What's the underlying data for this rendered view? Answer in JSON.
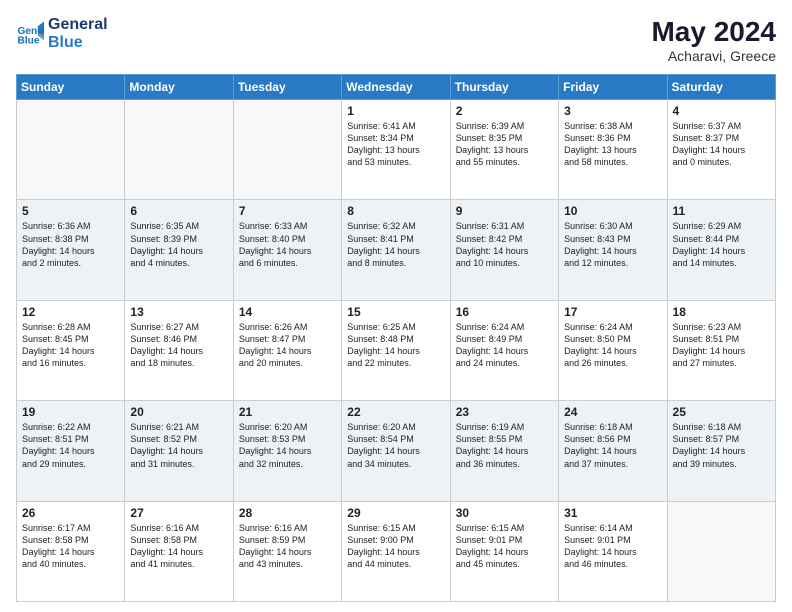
{
  "header": {
    "logo_line1": "General",
    "logo_line2": "Blue",
    "month_year": "May 2024",
    "location": "Acharavi, Greece"
  },
  "days_of_week": [
    "Sunday",
    "Monday",
    "Tuesday",
    "Wednesday",
    "Thursday",
    "Friday",
    "Saturday"
  ],
  "weeks": [
    [
      {
        "day": "",
        "text": ""
      },
      {
        "day": "",
        "text": ""
      },
      {
        "day": "",
        "text": ""
      },
      {
        "day": "1",
        "text": "Sunrise: 6:41 AM\nSunset: 8:34 PM\nDaylight: 13 hours\nand 53 minutes."
      },
      {
        "day": "2",
        "text": "Sunrise: 6:39 AM\nSunset: 8:35 PM\nDaylight: 13 hours\nand 55 minutes."
      },
      {
        "day": "3",
        "text": "Sunrise: 6:38 AM\nSunset: 8:36 PM\nDaylight: 13 hours\nand 58 minutes."
      },
      {
        "day": "4",
        "text": "Sunrise: 6:37 AM\nSunset: 8:37 PM\nDaylight: 14 hours\nand 0 minutes."
      }
    ],
    [
      {
        "day": "5",
        "text": "Sunrise: 6:36 AM\nSunset: 8:38 PM\nDaylight: 14 hours\nand 2 minutes."
      },
      {
        "day": "6",
        "text": "Sunrise: 6:35 AM\nSunset: 8:39 PM\nDaylight: 14 hours\nand 4 minutes."
      },
      {
        "day": "7",
        "text": "Sunrise: 6:33 AM\nSunset: 8:40 PM\nDaylight: 14 hours\nand 6 minutes."
      },
      {
        "day": "8",
        "text": "Sunrise: 6:32 AM\nSunset: 8:41 PM\nDaylight: 14 hours\nand 8 minutes."
      },
      {
        "day": "9",
        "text": "Sunrise: 6:31 AM\nSunset: 8:42 PM\nDaylight: 14 hours\nand 10 minutes."
      },
      {
        "day": "10",
        "text": "Sunrise: 6:30 AM\nSunset: 8:43 PM\nDaylight: 14 hours\nand 12 minutes."
      },
      {
        "day": "11",
        "text": "Sunrise: 6:29 AM\nSunset: 8:44 PM\nDaylight: 14 hours\nand 14 minutes."
      }
    ],
    [
      {
        "day": "12",
        "text": "Sunrise: 6:28 AM\nSunset: 8:45 PM\nDaylight: 14 hours\nand 16 minutes."
      },
      {
        "day": "13",
        "text": "Sunrise: 6:27 AM\nSunset: 8:46 PM\nDaylight: 14 hours\nand 18 minutes."
      },
      {
        "day": "14",
        "text": "Sunrise: 6:26 AM\nSunset: 8:47 PM\nDaylight: 14 hours\nand 20 minutes."
      },
      {
        "day": "15",
        "text": "Sunrise: 6:25 AM\nSunset: 8:48 PM\nDaylight: 14 hours\nand 22 minutes."
      },
      {
        "day": "16",
        "text": "Sunrise: 6:24 AM\nSunset: 8:49 PM\nDaylight: 14 hours\nand 24 minutes."
      },
      {
        "day": "17",
        "text": "Sunrise: 6:24 AM\nSunset: 8:50 PM\nDaylight: 14 hours\nand 26 minutes."
      },
      {
        "day": "18",
        "text": "Sunrise: 6:23 AM\nSunset: 8:51 PM\nDaylight: 14 hours\nand 27 minutes."
      }
    ],
    [
      {
        "day": "19",
        "text": "Sunrise: 6:22 AM\nSunset: 8:51 PM\nDaylight: 14 hours\nand 29 minutes."
      },
      {
        "day": "20",
        "text": "Sunrise: 6:21 AM\nSunset: 8:52 PM\nDaylight: 14 hours\nand 31 minutes."
      },
      {
        "day": "21",
        "text": "Sunrise: 6:20 AM\nSunset: 8:53 PM\nDaylight: 14 hours\nand 32 minutes."
      },
      {
        "day": "22",
        "text": "Sunrise: 6:20 AM\nSunset: 8:54 PM\nDaylight: 14 hours\nand 34 minutes."
      },
      {
        "day": "23",
        "text": "Sunrise: 6:19 AM\nSunset: 8:55 PM\nDaylight: 14 hours\nand 36 minutes."
      },
      {
        "day": "24",
        "text": "Sunrise: 6:18 AM\nSunset: 8:56 PM\nDaylight: 14 hours\nand 37 minutes."
      },
      {
        "day": "25",
        "text": "Sunrise: 6:18 AM\nSunset: 8:57 PM\nDaylight: 14 hours\nand 39 minutes."
      }
    ],
    [
      {
        "day": "26",
        "text": "Sunrise: 6:17 AM\nSunset: 8:58 PM\nDaylight: 14 hours\nand 40 minutes."
      },
      {
        "day": "27",
        "text": "Sunrise: 6:16 AM\nSunset: 8:58 PM\nDaylight: 14 hours\nand 41 minutes."
      },
      {
        "day": "28",
        "text": "Sunrise: 6:16 AM\nSunset: 8:59 PM\nDaylight: 14 hours\nand 43 minutes."
      },
      {
        "day": "29",
        "text": "Sunrise: 6:15 AM\nSunset: 9:00 PM\nDaylight: 14 hours\nand 44 minutes."
      },
      {
        "day": "30",
        "text": "Sunrise: 6:15 AM\nSunset: 9:01 PM\nDaylight: 14 hours\nand 45 minutes."
      },
      {
        "day": "31",
        "text": "Sunrise: 6:14 AM\nSunset: 9:01 PM\nDaylight: 14 hours\nand 46 minutes."
      },
      {
        "day": "",
        "text": ""
      }
    ]
  ]
}
